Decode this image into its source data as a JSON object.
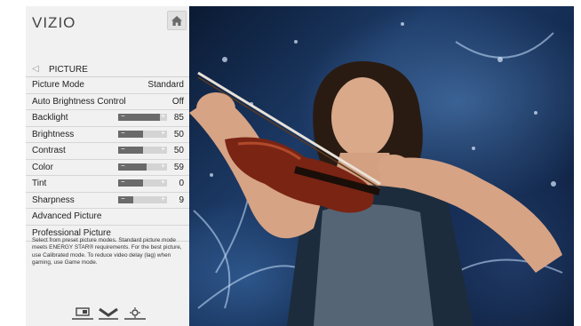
{
  "brand": "VIZIO",
  "home_icon": "home-icon",
  "menu": {
    "section_title": "PICTURE",
    "rows": [
      {
        "label": "Picture Mode",
        "value": "Standard"
      },
      {
        "label": "Auto Brightness Control",
        "value": "Off"
      },
      {
        "label": "Backlight",
        "value": "85",
        "level": 0.85
      },
      {
        "label": "Brightness",
        "value": "50",
        "level": 0.5
      },
      {
        "label": "Contrast",
        "value": "50",
        "level": 0.5
      },
      {
        "label": "Color",
        "value": "59",
        "level": 0.59
      },
      {
        "label": "Tint",
        "value": "0",
        "level": 0.5
      },
      {
        "label": "Sharpness",
        "value": "9",
        "level": 0.3
      },
      {
        "label": "Advanced Picture",
        "value": ""
      },
      {
        "label": "Professional Picture",
        "value": ""
      }
    ],
    "description": "Select from preset picture modes. Standard picture mode meets ENERGY STAR® requirements. For the best picture, use Calibrated mode. To reduce video delay (lag) when gaming, use Game mode."
  },
  "bottom_icons": [
    "screen-icon",
    "chevron-down-icon",
    "settings-icon"
  ],
  "colors": {
    "panel_bg": "#f1f1f1",
    "slider_fill": "#6a6a6a",
    "slider_track": "#d4d4d4"
  }
}
